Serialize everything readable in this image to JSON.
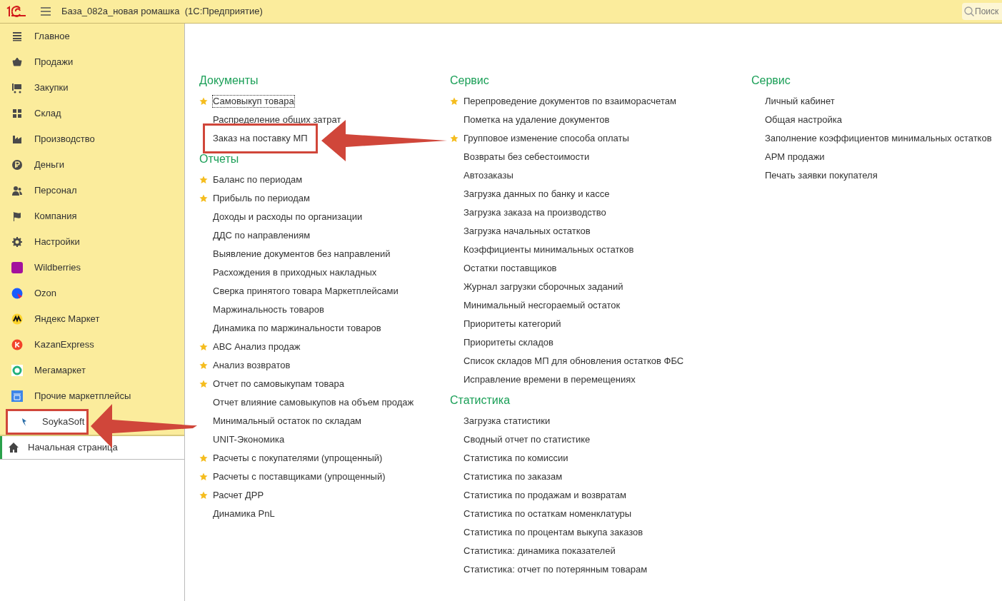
{
  "window": {
    "title": "База_082а_новая ромашка  (1С:Предприятие)",
    "search": {
      "placeholder": "Поиск"
    }
  },
  "sidebar": {
    "items": [
      {
        "label": "Главное",
        "selected": false,
        "highlighted": false
      },
      {
        "label": "Продажи",
        "selected": false,
        "highlighted": false
      },
      {
        "label": "Закупки",
        "selected": false,
        "highlighted": false
      },
      {
        "label": "Склад",
        "selected": false,
        "highlighted": false
      },
      {
        "label": "Производство",
        "selected": false,
        "highlighted": false
      },
      {
        "label": "Деньги",
        "selected": false,
        "highlighted": false
      },
      {
        "label": "Персонал",
        "selected": false,
        "highlighted": false
      },
      {
        "label": "Компания",
        "selected": false,
        "highlighted": false
      },
      {
        "label": "Настройки",
        "selected": false,
        "highlighted": false
      },
      {
        "label": "Wildberries",
        "selected": false,
        "highlighted": false
      },
      {
        "label": "Ozon",
        "selected": false,
        "highlighted": false
      },
      {
        "label": "Яндекс Маркет",
        "selected": false,
        "highlighted": false
      },
      {
        "label": "KazanExpress",
        "selected": false,
        "highlighted": false
      },
      {
        "label": "Мегамаркет",
        "selected": false,
        "highlighted": false
      },
      {
        "label": "Прочие маркетплейсы",
        "selected": false,
        "highlighted": false
      },
      {
        "label": "SoykaSoft",
        "selected": true,
        "highlighted": true
      }
    ],
    "open_pages": [
      {
        "label": "Начальная страница",
        "active": true
      }
    ]
  },
  "columns": [
    {
      "sections": [
        {
          "title": "Документы",
          "items": [
            {
              "label": "Самовыкуп товара",
              "favorite": true,
              "focused": true,
              "highlighted": false
            },
            {
              "label": "Распределение общих затрат",
              "favorite": false,
              "focused": false,
              "highlighted": false
            },
            {
              "label": "Заказ на поставку МП",
              "favorite": false,
              "focused": false,
              "highlighted": true
            }
          ]
        },
        {
          "title": "Отчеты",
          "items": [
            {
              "label": "Баланс по периодам",
              "favorite": true,
              "focused": false,
              "highlighted": false
            },
            {
              "label": "Прибыль по периодам",
              "favorite": true,
              "focused": false,
              "highlighted": false
            },
            {
              "label": "Доходы и расходы по организации",
              "favorite": false,
              "focused": false,
              "highlighted": false
            },
            {
              "label": "ДДС по направлениям",
              "favorite": false,
              "focused": false,
              "highlighted": false
            },
            {
              "label": "Выявление документов без направлений",
              "favorite": false,
              "focused": false,
              "highlighted": false
            },
            {
              "label": "Расхождения в приходных накладных",
              "favorite": false,
              "focused": false,
              "highlighted": false
            },
            {
              "label": "Сверка принятого товара Маркетплейсами",
              "favorite": false,
              "focused": false,
              "highlighted": false
            },
            {
              "label": "Маржинальность товаров",
              "favorite": false,
              "focused": false,
              "highlighted": false
            },
            {
              "label": "Динамика по маржинальности товаров",
              "favorite": false,
              "focused": false,
              "highlighted": false
            },
            {
              "label": "ABC Анализ продаж",
              "favorite": true,
              "focused": false,
              "highlighted": false
            },
            {
              "label": "Анализ возвратов",
              "favorite": true,
              "focused": false,
              "highlighted": false
            },
            {
              "label": "Отчет по самовыкупам товара",
              "favorite": true,
              "focused": false,
              "highlighted": false
            },
            {
              "label": "Отчет влияние самовыкупов на объем продаж",
              "favorite": false,
              "focused": false,
              "highlighted": false
            },
            {
              "label": "Минимальный остаток по складам",
              "favorite": false,
              "focused": false,
              "highlighted": false
            },
            {
              "label": "UNIT-Экономика",
              "favorite": false,
              "focused": false,
              "highlighted": false
            },
            {
              "label": "Расчеты с покупателями (упрощенный)",
              "favorite": true,
              "focused": false,
              "highlighted": false
            },
            {
              "label": "Расчеты с поставщиками (упрощенный)",
              "favorite": true,
              "focused": false,
              "highlighted": false
            },
            {
              "label": "Расчет ДРР",
              "favorite": true,
              "focused": false,
              "highlighted": false
            },
            {
              "label": "Динамика PnL",
              "favorite": false,
              "focused": false,
              "highlighted": false
            }
          ]
        }
      ]
    },
    {
      "sections": [
        {
          "title": "Сервис",
          "items": [
            {
              "label": "Перепроведение документов по взаиморасчетам",
              "favorite": true,
              "focused": false,
              "highlighted": false
            },
            {
              "label": "Пометка на удаление документов",
              "favorite": false,
              "focused": false,
              "highlighted": false
            },
            {
              "label": "Групповое изменение способа оплаты",
              "favorite": true,
              "focused": false,
              "highlighted": false
            },
            {
              "label": "Возвраты без себестоимости",
              "favorite": false,
              "focused": false,
              "highlighted": false
            },
            {
              "label": "Автозаказы",
              "favorite": false,
              "focused": false,
              "highlighted": false
            },
            {
              "label": "Загрузка данных по банку и кассе",
              "favorite": false,
              "focused": false,
              "highlighted": false
            },
            {
              "label": "Загрузка заказа на производство",
              "favorite": false,
              "focused": false,
              "highlighted": false
            },
            {
              "label": "Загрузка начальных остатков",
              "favorite": false,
              "focused": false,
              "highlighted": false
            },
            {
              "label": "Коэффициенты минимальных остатков",
              "favorite": false,
              "focused": false,
              "highlighted": false
            },
            {
              "label": "Остатки поставщиков",
              "favorite": false,
              "focused": false,
              "highlighted": false
            },
            {
              "label": "Журнал загрузки сборочных заданий",
              "favorite": false,
              "focused": false,
              "highlighted": false
            },
            {
              "label": "Минимальный несгораемый остаток",
              "favorite": false,
              "focused": false,
              "highlighted": false
            },
            {
              "label": "Приоритеты категорий",
              "favorite": false,
              "focused": false,
              "highlighted": false
            },
            {
              "label": "Приоритеты складов",
              "favorite": false,
              "focused": false,
              "highlighted": false
            },
            {
              "label": "Список складов МП для обновления остатков ФБС",
              "favorite": false,
              "focused": false,
              "highlighted": false
            },
            {
              "label": "Исправление времени в перемещениях",
              "favorite": false,
              "focused": false,
              "highlighted": false
            }
          ]
        },
        {
          "title": "Статистика",
          "items": [
            {
              "label": "Загрузка статистики",
              "favorite": false,
              "focused": false,
              "highlighted": false
            },
            {
              "label": "Сводный отчет по статистике",
              "favorite": false,
              "focused": false,
              "highlighted": false
            },
            {
              "label": "Статистика по комиссии",
              "favorite": false,
              "focused": false,
              "highlighted": false
            },
            {
              "label": "Статистика по заказам",
              "favorite": false,
              "focused": false,
              "highlighted": false
            },
            {
              "label": "Статистика по продажам и возвратам",
              "favorite": false,
              "focused": false,
              "highlighted": false
            },
            {
              "label": "Статистика по остаткам номенклатуры",
              "favorite": false,
              "focused": false,
              "highlighted": false
            },
            {
              "label": "Статистика по процентам выкупа заказов",
              "favorite": false,
              "focused": false,
              "highlighted": false
            },
            {
              "label": "Статистика: динамика показателей",
              "favorite": false,
              "focused": false,
              "highlighted": false
            },
            {
              "label": "Статистика: отчет по потерянным товарам",
              "favorite": false,
              "focused": false,
              "highlighted": false
            }
          ]
        }
      ]
    },
    {
      "sections": [
        {
          "title": "Сервис",
          "items": [
            {
              "label": "Личный кабинет",
              "favorite": false,
              "focused": false,
              "highlighted": false
            },
            {
              "label": "Общая настройка",
              "favorite": false,
              "focused": false,
              "highlighted": false
            },
            {
              "label": "Заполнение коэффициентов минимальных остатков",
              "favorite": false,
              "focused": false,
              "highlighted": false
            },
            {
              "label": "АРМ продажи",
              "favorite": false,
              "focused": false,
              "highlighted": false
            },
            {
              "label": "Печать заявки покупателя",
              "favorite": false,
              "focused": false,
              "highlighted": false
            }
          ]
        }
      ]
    }
  ]
}
